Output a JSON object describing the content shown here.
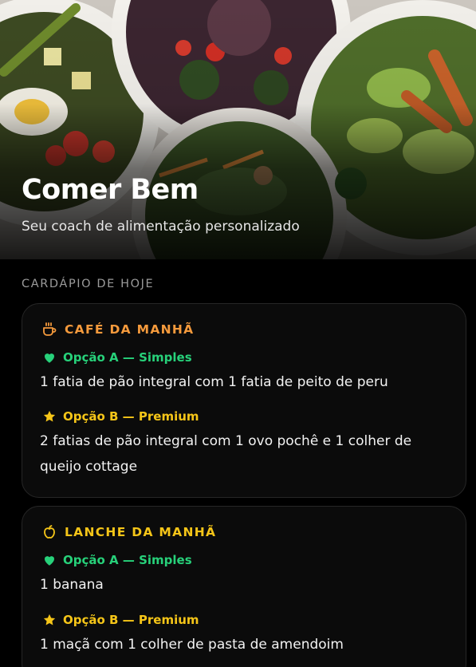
{
  "hero": {
    "title": "Comer Bem",
    "subtitle": "Seu coach de alimentação personalizado"
  },
  "section_label": "CARDÁPIO DE HOJE",
  "meals": [
    {
      "title": "CAFÉ DA MANHÃ",
      "icon": "coffee-cup-icon",
      "title_color": "#f59a3c",
      "option_a": {
        "label": "Opção A — Simples",
        "icon": "heart-icon",
        "color": "#27d17a",
        "description": "1 fatia de pão integral com 1 fatia de peito de peru"
      },
      "option_b": {
        "label": "Opção B — Premium",
        "icon": "star-icon",
        "color": "#f5c518",
        "description": "2 fatias de pão integral com 1 ovo pochê e 1 colher de queijo cottage"
      }
    },
    {
      "title": "LANCHE DA MANHÃ",
      "icon": "apple-icon",
      "title_color": "#f5c518",
      "option_a": {
        "label": "Opção A — Simples",
        "icon": "heart-icon",
        "color": "#27d17a",
        "description": "1 banana"
      },
      "option_b": {
        "label": "Opção B — Premium",
        "icon": "star-icon",
        "color": "#f5c518",
        "description": "1 maçã com 1 colher de pasta de amendoim"
      }
    }
  ]
}
